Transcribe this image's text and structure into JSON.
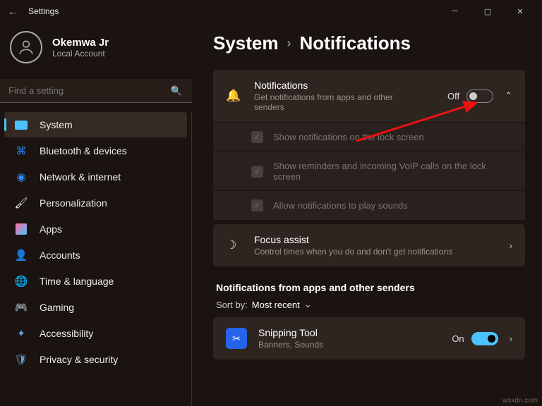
{
  "titlebar": {
    "title": "Settings"
  },
  "user": {
    "name": "Okemwa Jr",
    "account": "Local Account"
  },
  "search": {
    "placeholder": "Find a setting"
  },
  "nav": [
    {
      "label": "System",
      "icon": "system"
    },
    {
      "label": "Bluetooth & devices",
      "icon": "bluetooth"
    },
    {
      "label": "Network & internet",
      "icon": "wifi"
    },
    {
      "label": "Personalization",
      "icon": "brush"
    },
    {
      "label": "Apps",
      "icon": "apps"
    },
    {
      "label": "Accounts",
      "icon": "person"
    },
    {
      "label": "Time & language",
      "icon": "globe"
    },
    {
      "label": "Gaming",
      "icon": "game"
    },
    {
      "label": "Accessibility",
      "icon": "access"
    },
    {
      "label": "Privacy & security",
      "icon": "shield"
    }
  ],
  "breadcrumb": {
    "parent": "System",
    "current": "Notifications"
  },
  "notif": {
    "title": "Notifications",
    "desc": "Get notifications from apps and other senders",
    "state": "Off",
    "sub1": "Show notifications on the lock screen",
    "sub2": "Show reminders and incoming VoIP calls on the lock screen",
    "sub3": "Allow notifications to play sounds"
  },
  "focus": {
    "title": "Focus assist",
    "desc": "Control times when you do and don't get notifications"
  },
  "section": "Notifications from apps and other senders",
  "sort": {
    "label": "Sort by:",
    "value": "Most recent"
  },
  "app1": {
    "name": "Snipping Tool",
    "desc": "Banners, Sounds",
    "state": "On"
  },
  "watermark": "wsxdn.com"
}
